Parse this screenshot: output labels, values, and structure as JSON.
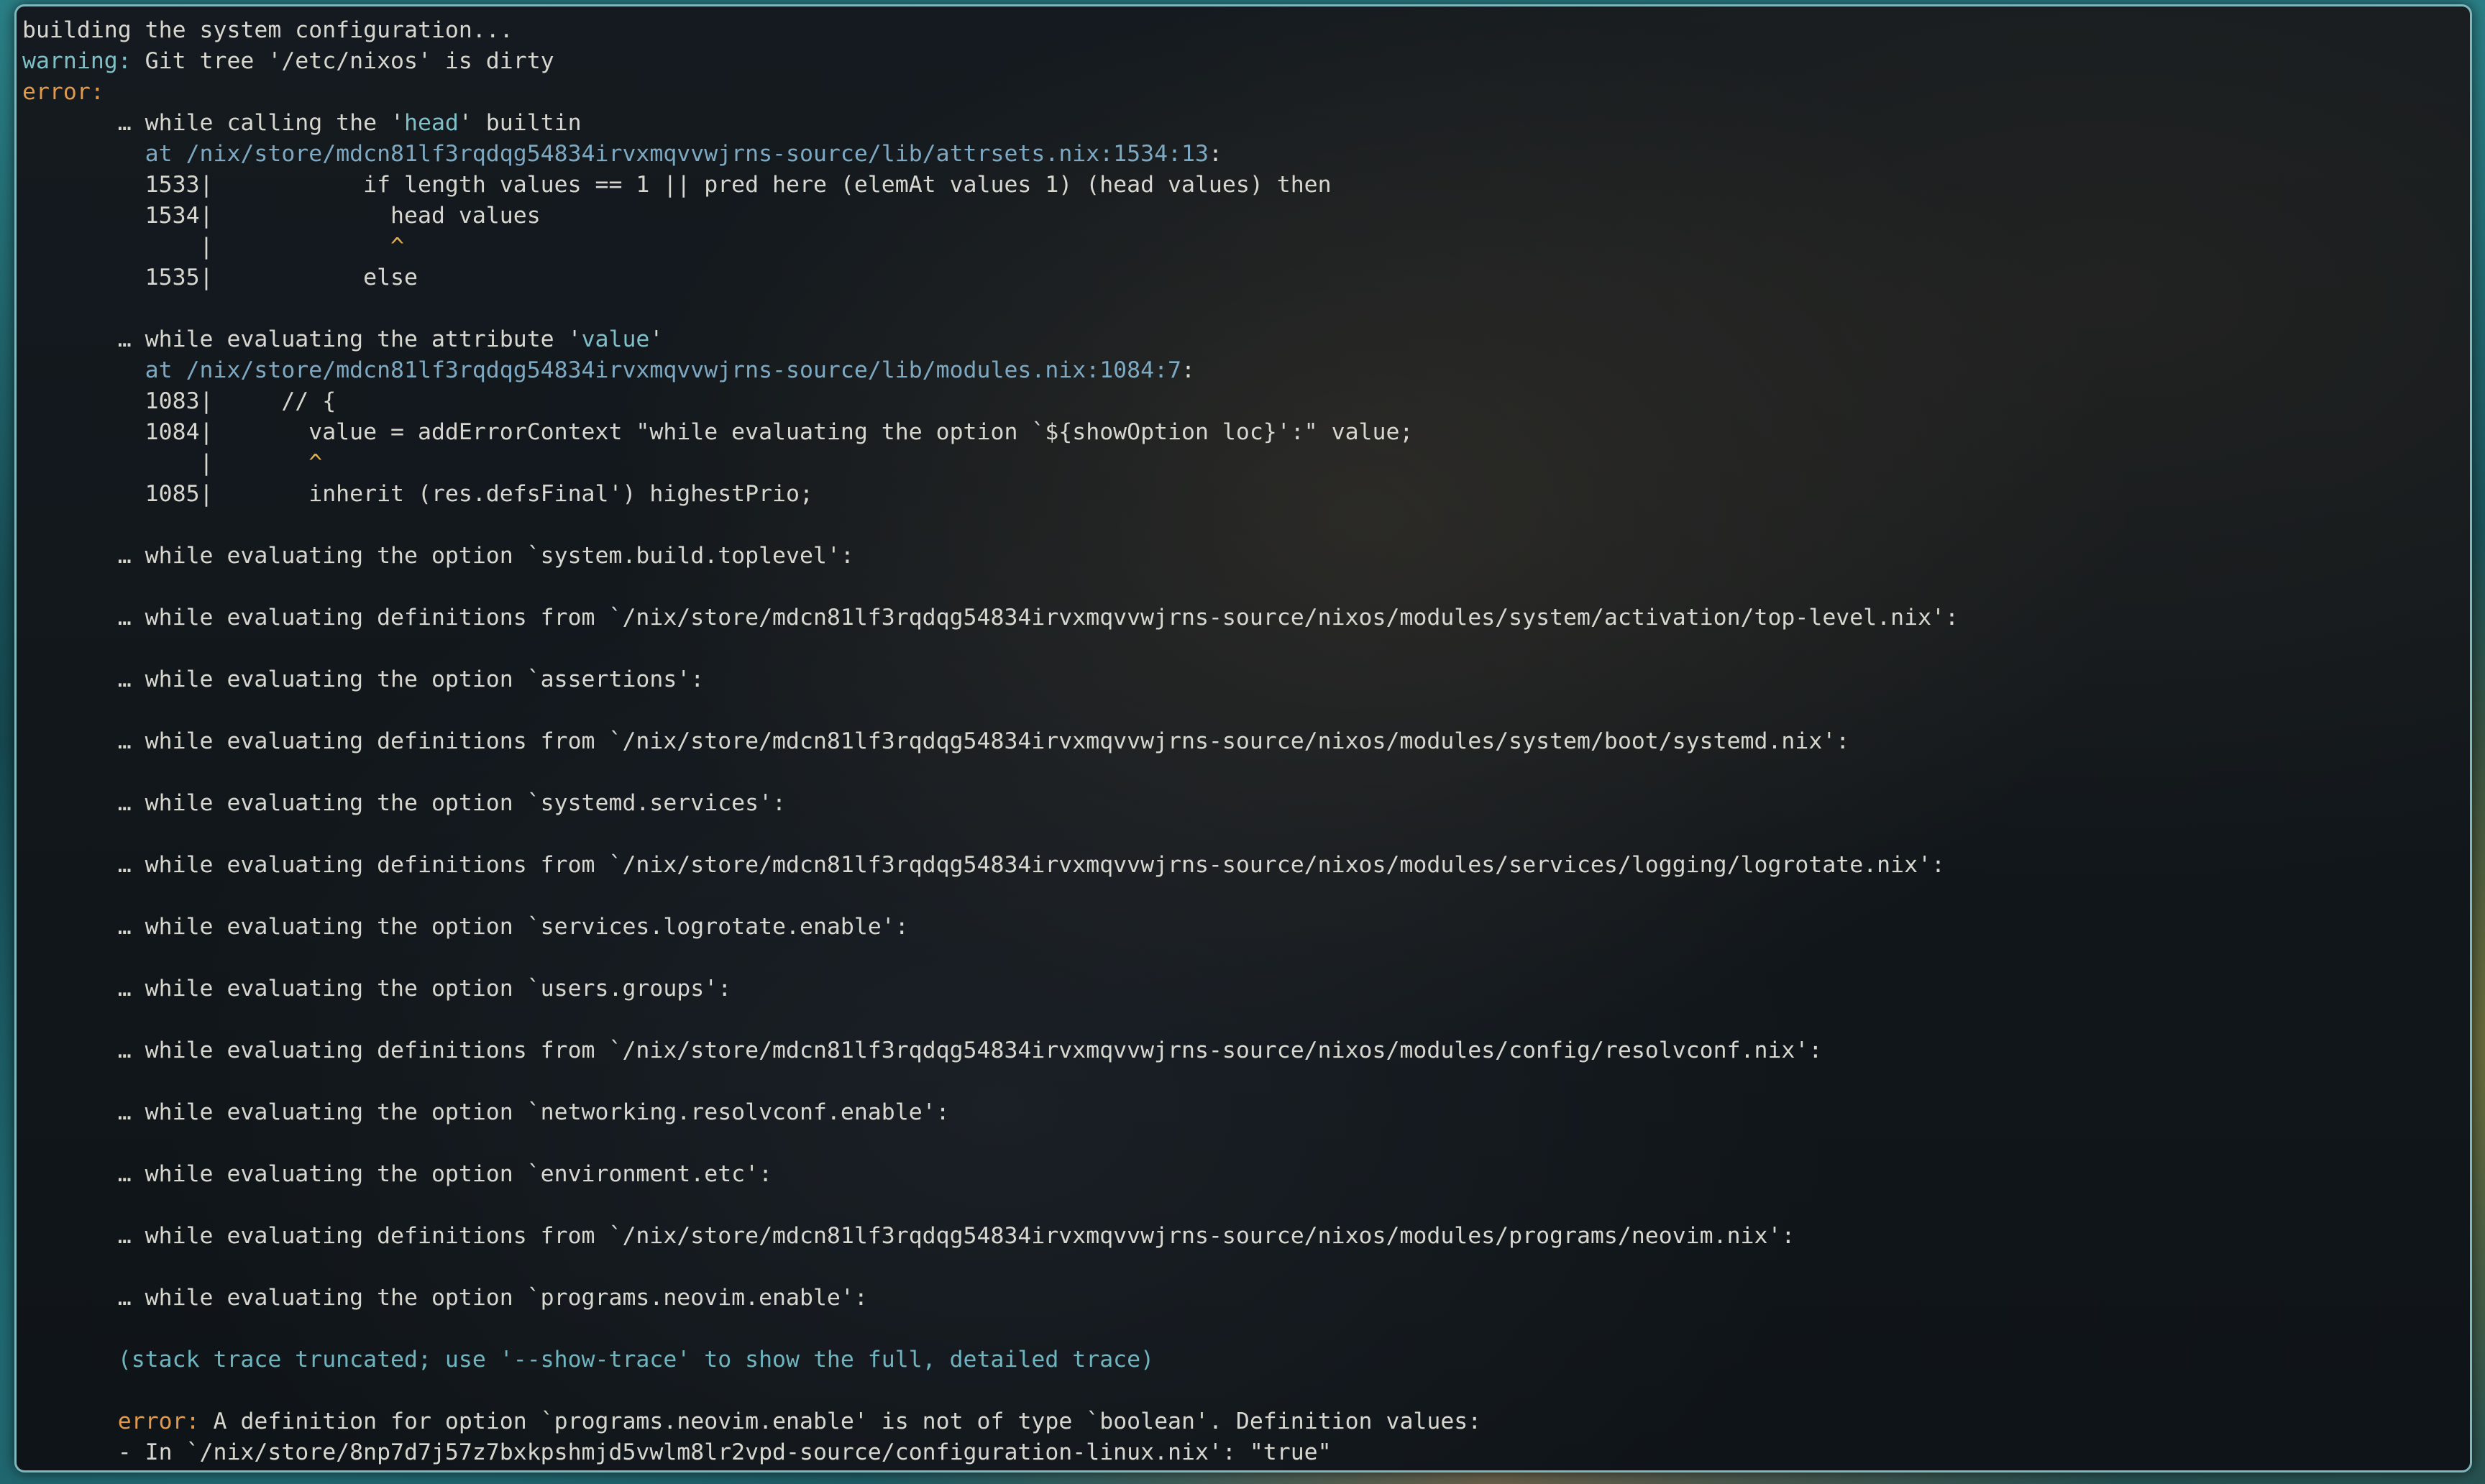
{
  "window": {
    "accent": "#7fb7bd",
    "background": "#12181c"
  },
  "colors": {
    "text": "#d7d7cf",
    "warning": "#7ec0c8",
    "error": "#e09a4e",
    "path": "#7ea9c2",
    "attribute_name": "#7ec0c8",
    "caret": "#e0b050",
    "note": "#6fb5bf"
  },
  "terminal": {
    "lines": [
      {
        "segments": [
          {
            "text": "building the system configuration...",
            "style": "plain"
          }
        ]
      },
      {
        "segments": [
          {
            "text": "warning:",
            "style": "warn"
          },
          {
            "text": " Git tree '/etc/nixos' is dirty",
            "style": "plain"
          }
        ]
      },
      {
        "segments": [
          {
            "text": "error:",
            "style": "err"
          }
        ]
      },
      {
        "segments": [
          {
            "text": "       … while calling the '",
            "style": "plain"
          },
          {
            "text": "head",
            "style": "name"
          },
          {
            "text": "' builtin",
            "style": "plain"
          }
        ]
      },
      {
        "segments": [
          {
            "text": "         at ",
            "style": "path"
          },
          {
            "text": "/nix/store/mdcn81lf3rqdqg54834irvxmqvvwjrns-source/lib/attrsets.nix:1534:13",
            "style": "path"
          },
          {
            "text": ":",
            "style": "plain"
          }
        ]
      },
      {
        "segments": [
          {
            "text": "         1533|           if length values == 1 || pred here (elemAt values 1) (head values) then",
            "style": "plain"
          }
        ]
      },
      {
        "segments": [
          {
            "text": "         1534|             head values",
            "style": "plain"
          }
        ]
      },
      {
        "segments": [
          {
            "text": "             |             ",
            "style": "plain"
          },
          {
            "text": "^",
            "style": "caret"
          }
        ]
      },
      {
        "segments": [
          {
            "text": "         1535|           else",
            "style": "plain"
          }
        ]
      },
      {
        "segments": [
          {
            "text": "",
            "style": "plain"
          }
        ]
      },
      {
        "segments": [
          {
            "text": "       … while evaluating the attribute '",
            "style": "plain"
          },
          {
            "text": "value",
            "style": "name"
          },
          {
            "text": "'",
            "style": "plain"
          }
        ]
      },
      {
        "segments": [
          {
            "text": "         at ",
            "style": "path"
          },
          {
            "text": "/nix/store/mdcn81lf3rqdqg54834irvxmqvvwjrns-source/lib/modules.nix:1084:7",
            "style": "path"
          },
          {
            "text": ":",
            "style": "plain"
          }
        ]
      },
      {
        "segments": [
          {
            "text": "         1083|     // {",
            "style": "plain"
          }
        ]
      },
      {
        "segments": [
          {
            "text": "         1084|       value = addErrorContext \"while evaluating the option `${showOption loc}':\" value;",
            "style": "plain"
          }
        ]
      },
      {
        "segments": [
          {
            "text": "             |       ",
            "style": "plain"
          },
          {
            "text": "^",
            "style": "caret"
          }
        ]
      },
      {
        "segments": [
          {
            "text": "         1085|       inherit (res.defsFinal') highestPrio;",
            "style": "plain"
          }
        ]
      },
      {
        "segments": [
          {
            "text": "",
            "style": "plain"
          }
        ]
      },
      {
        "segments": [
          {
            "text": "       … while evaluating the option `system.build.toplevel':",
            "style": "plain"
          }
        ]
      },
      {
        "segments": [
          {
            "text": "",
            "style": "plain"
          }
        ]
      },
      {
        "segments": [
          {
            "text": "       … while evaluating definitions from `/nix/store/mdcn81lf3rqdqg54834irvxmqvvwjrns-source/nixos/modules/system/activation/top-level.nix':",
            "style": "plain"
          }
        ]
      },
      {
        "segments": [
          {
            "text": "",
            "style": "plain"
          }
        ]
      },
      {
        "segments": [
          {
            "text": "       … while evaluating the option `assertions':",
            "style": "plain"
          }
        ]
      },
      {
        "segments": [
          {
            "text": "",
            "style": "plain"
          }
        ]
      },
      {
        "segments": [
          {
            "text": "       … while evaluating definitions from `/nix/store/mdcn81lf3rqdqg54834irvxmqvvwjrns-source/nixos/modules/system/boot/systemd.nix':",
            "style": "plain"
          }
        ]
      },
      {
        "segments": [
          {
            "text": "",
            "style": "plain"
          }
        ]
      },
      {
        "segments": [
          {
            "text": "       … while evaluating the option `systemd.services':",
            "style": "plain"
          }
        ]
      },
      {
        "segments": [
          {
            "text": "",
            "style": "plain"
          }
        ]
      },
      {
        "segments": [
          {
            "text": "       … while evaluating definitions from `/nix/store/mdcn81lf3rqdqg54834irvxmqvvwjrns-source/nixos/modules/services/logging/logrotate.nix':",
            "style": "plain"
          }
        ]
      },
      {
        "segments": [
          {
            "text": "",
            "style": "plain"
          }
        ]
      },
      {
        "segments": [
          {
            "text": "       … while evaluating the option `services.logrotate.enable':",
            "style": "plain"
          }
        ]
      },
      {
        "segments": [
          {
            "text": "",
            "style": "plain"
          }
        ]
      },
      {
        "segments": [
          {
            "text": "       … while evaluating the option `users.groups':",
            "style": "plain"
          }
        ]
      },
      {
        "segments": [
          {
            "text": "",
            "style": "plain"
          }
        ]
      },
      {
        "segments": [
          {
            "text": "       … while evaluating definitions from `/nix/store/mdcn81lf3rqdqg54834irvxmqvvwjrns-source/nixos/modules/config/resolvconf.nix':",
            "style": "plain"
          }
        ]
      },
      {
        "segments": [
          {
            "text": "",
            "style": "plain"
          }
        ]
      },
      {
        "segments": [
          {
            "text": "       … while evaluating the option `networking.resolvconf.enable':",
            "style": "plain"
          }
        ]
      },
      {
        "segments": [
          {
            "text": "",
            "style": "plain"
          }
        ]
      },
      {
        "segments": [
          {
            "text": "       … while evaluating the option `environment.etc':",
            "style": "plain"
          }
        ]
      },
      {
        "segments": [
          {
            "text": "",
            "style": "plain"
          }
        ]
      },
      {
        "segments": [
          {
            "text": "       … while evaluating definitions from `/nix/store/mdcn81lf3rqdqg54834irvxmqvvwjrns-source/nixos/modules/programs/neovim.nix':",
            "style": "plain"
          }
        ]
      },
      {
        "segments": [
          {
            "text": "",
            "style": "plain"
          }
        ]
      },
      {
        "segments": [
          {
            "text": "       … while evaluating the option `programs.neovim.enable':",
            "style": "plain"
          }
        ]
      },
      {
        "segments": [
          {
            "text": "",
            "style": "plain"
          }
        ]
      },
      {
        "segments": [
          {
            "text": "       (stack trace truncated; use '--show-trace' to show the full, detailed trace)",
            "style": "note"
          }
        ]
      },
      {
        "segments": [
          {
            "text": "",
            "style": "plain"
          }
        ]
      },
      {
        "segments": [
          {
            "text": "       ",
            "style": "plain"
          },
          {
            "text": "error:",
            "style": "err"
          },
          {
            "text": " A definition for option `programs.neovim.enable' is not of type `boolean'. Definition values:",
            "style": "plain"
          }
        ]
      },
      {
        "segments": [
          {
            "text": "       - In `/nix/store/8np7d7j57z7bxkpshmjd5vwlm8lr2vpd-source/configuration-linux.nix': \"true\"",
            "style": "plain"
          }
        ]
      }
    ]
  }
}
